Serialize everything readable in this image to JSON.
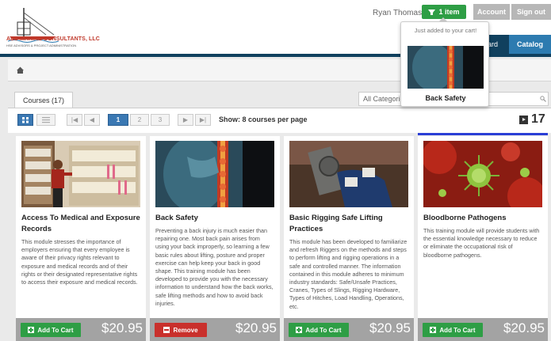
{
  "header": {
    "company": "AES MARINE CONSULTANTS, LLC",
    "company_sub": "HSE ADVISORS & PROJECT ADMINISTRATION",
    "username": "Ryan Thomas",
    "cart_label": "1 item",
    "account_label": "Account",
    "signout_label": "Sign out"
  },
  "nav": {
    "dashboard_label": "oard",
    "catalog_label": "Catalog"
  },
  "tabs": {
    "courses_label": "Courses (17)"
  },
  "filter": {
    "selected": "All Categorie"
  },
  "pagination": {
    "pages": [
      "1",
      "2",
      "3"
    ],
    "active": "1",
    "show_label": "Show: 8 courses per page",
    "total": "17"
  },
  "popup": {
    "message": "Just added to your cart!",
    "title": "Back Safety"
  },
  "cards": [
    {
      "title": "Access To Medical and Exposure Records",
      "description": "This module stresses the importance of employers ensuring that every employee is aware of their privacy rights relevant to exposure and medical records and of their rights or their designated representative rights to access their exposure and medical records.",
      "button": "Add To Cart",
      "price": "$20.95"
    },
    {
      "title": "Back Safety",
      "description": "Preventing a back injury is much easier than repairing one. Most back pain arises from using your back improperly, so learning a few basic rules about lifting, posture and proper exercise can help keep your back in good shape. This training module has been developed to provide you with the necessary information to understand how the back works, safe lifting methods and how to avoid back injuries.",
      "button": "Remove",
      "price": "$20.95"
    },
    {
      "title": "Basic Rigging Safe Lifting Practices",
      "description": "This module has been developed to familiarize and refresh Riggers on the methods and steps to perform lifting and rigging operations in a safe and controlled manner. The information contained in this module adheres to minimum industry standards: Safe/Unsafe Practices, Cranes, Types of Slings, Rigging Hardware, Types of Hitches, Load Handling, Operations, etc.",
      "button": "Add To Cart",
      "price": "$20.95"
    },
    {
      "title": "Bloodborne Pathogens",
      "description": "This training module will provide students with the essential knowledge necessary to reduce or eliminate the occupational risk of bloodborne pathogens.",
      "button": "Add To Cart",
      "price": "$20.95"
    }
  ],
  "colors": {
    "brand_green": "#2e9e45",
    "brand_navy": "#10405e",
    "catalog_blue": "#2d7bb0",
    "remove_red": "#c9302c",
    "footer_gray": "#a3a3a3"
  },
  "icons": [
    "home-icon",
    "cart-icon",
    "grid-view-icon",
    "list-view-icon",
    "first-page-icon",
    "prev-page-icon",
    "next-page-icon",
    "last-page-icon",
    "search-icon",
    "course-count-icon"
  ]
}
